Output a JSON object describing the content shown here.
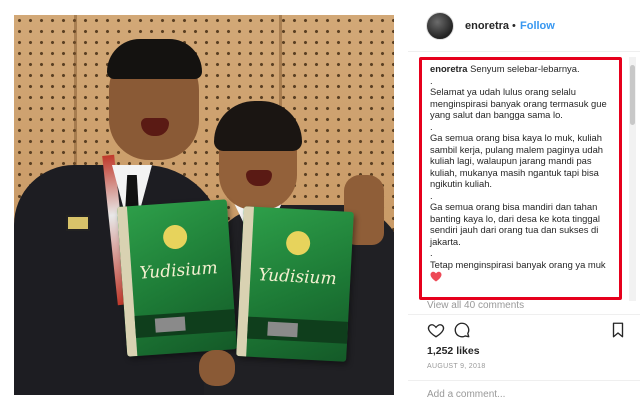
{
  "post": {
    "username": "enoretra",
    "dot": "•",
    "follow_label": "Follow"
  },
  "caption": {
    "username": "enoretra",
    "lines": [
      {
        "type": "first",
        "text": "Senyum selebar-lebarnya."
      },
      {
        "type": "sep",
        "text": "."
      },
      {
        "type": "text",
        "text": "Selamat ya udah lulus orang selalu menginspirasi banyak orang termasuk gue yang salut dan bangga sama lo."
      },
      {
        "type": "sep",
        "text": "."
      },
      {
        "type": "text",
        "text": "Ga semua orang bisa kaya lo muk, kuliah sambil kerja, pulang malem paginya udah kuliah lagi, walaupun jarang mandi pas kuliah, mukanya masih ngantuk tapi bisa ngikutin kuliah."
      },
      {
        "type": "sep",
        "text": "."
      },
      {
        "type": "text",
        "text": "Ga semua orang bisa mandiri dan tahan banting kaya lo, dari desa ke kota tinggal sendiri jauh dari orang tua dan sukses di jakarta."
      },
      {
        "type": "sep",
        "text": "."
      },
      {
        "type": "text",
        "text": "Tetap menginspirasi banyak orang ya muk"
      }
    ],
    "heart_color": "#ed4956",
    "highlight_color": "#e6001c"
  },
  "view_all_comments": "View all 40 comments",
  "likes": "1,252 likes",
  "date": "AUGUST 9, 2018",
  "add_comment_placeholder": "Add a comment...",
  "book_title": "Yudisium",
  "icons": {
    "like": "heart-outline-icon",
    "comment": "speech-bubble-icon",
    "save": "bookmark-icon"
  },
  "colors": {
    "link_blue": "#3897f0",
    "muted_text": "#999999"
  }
}
